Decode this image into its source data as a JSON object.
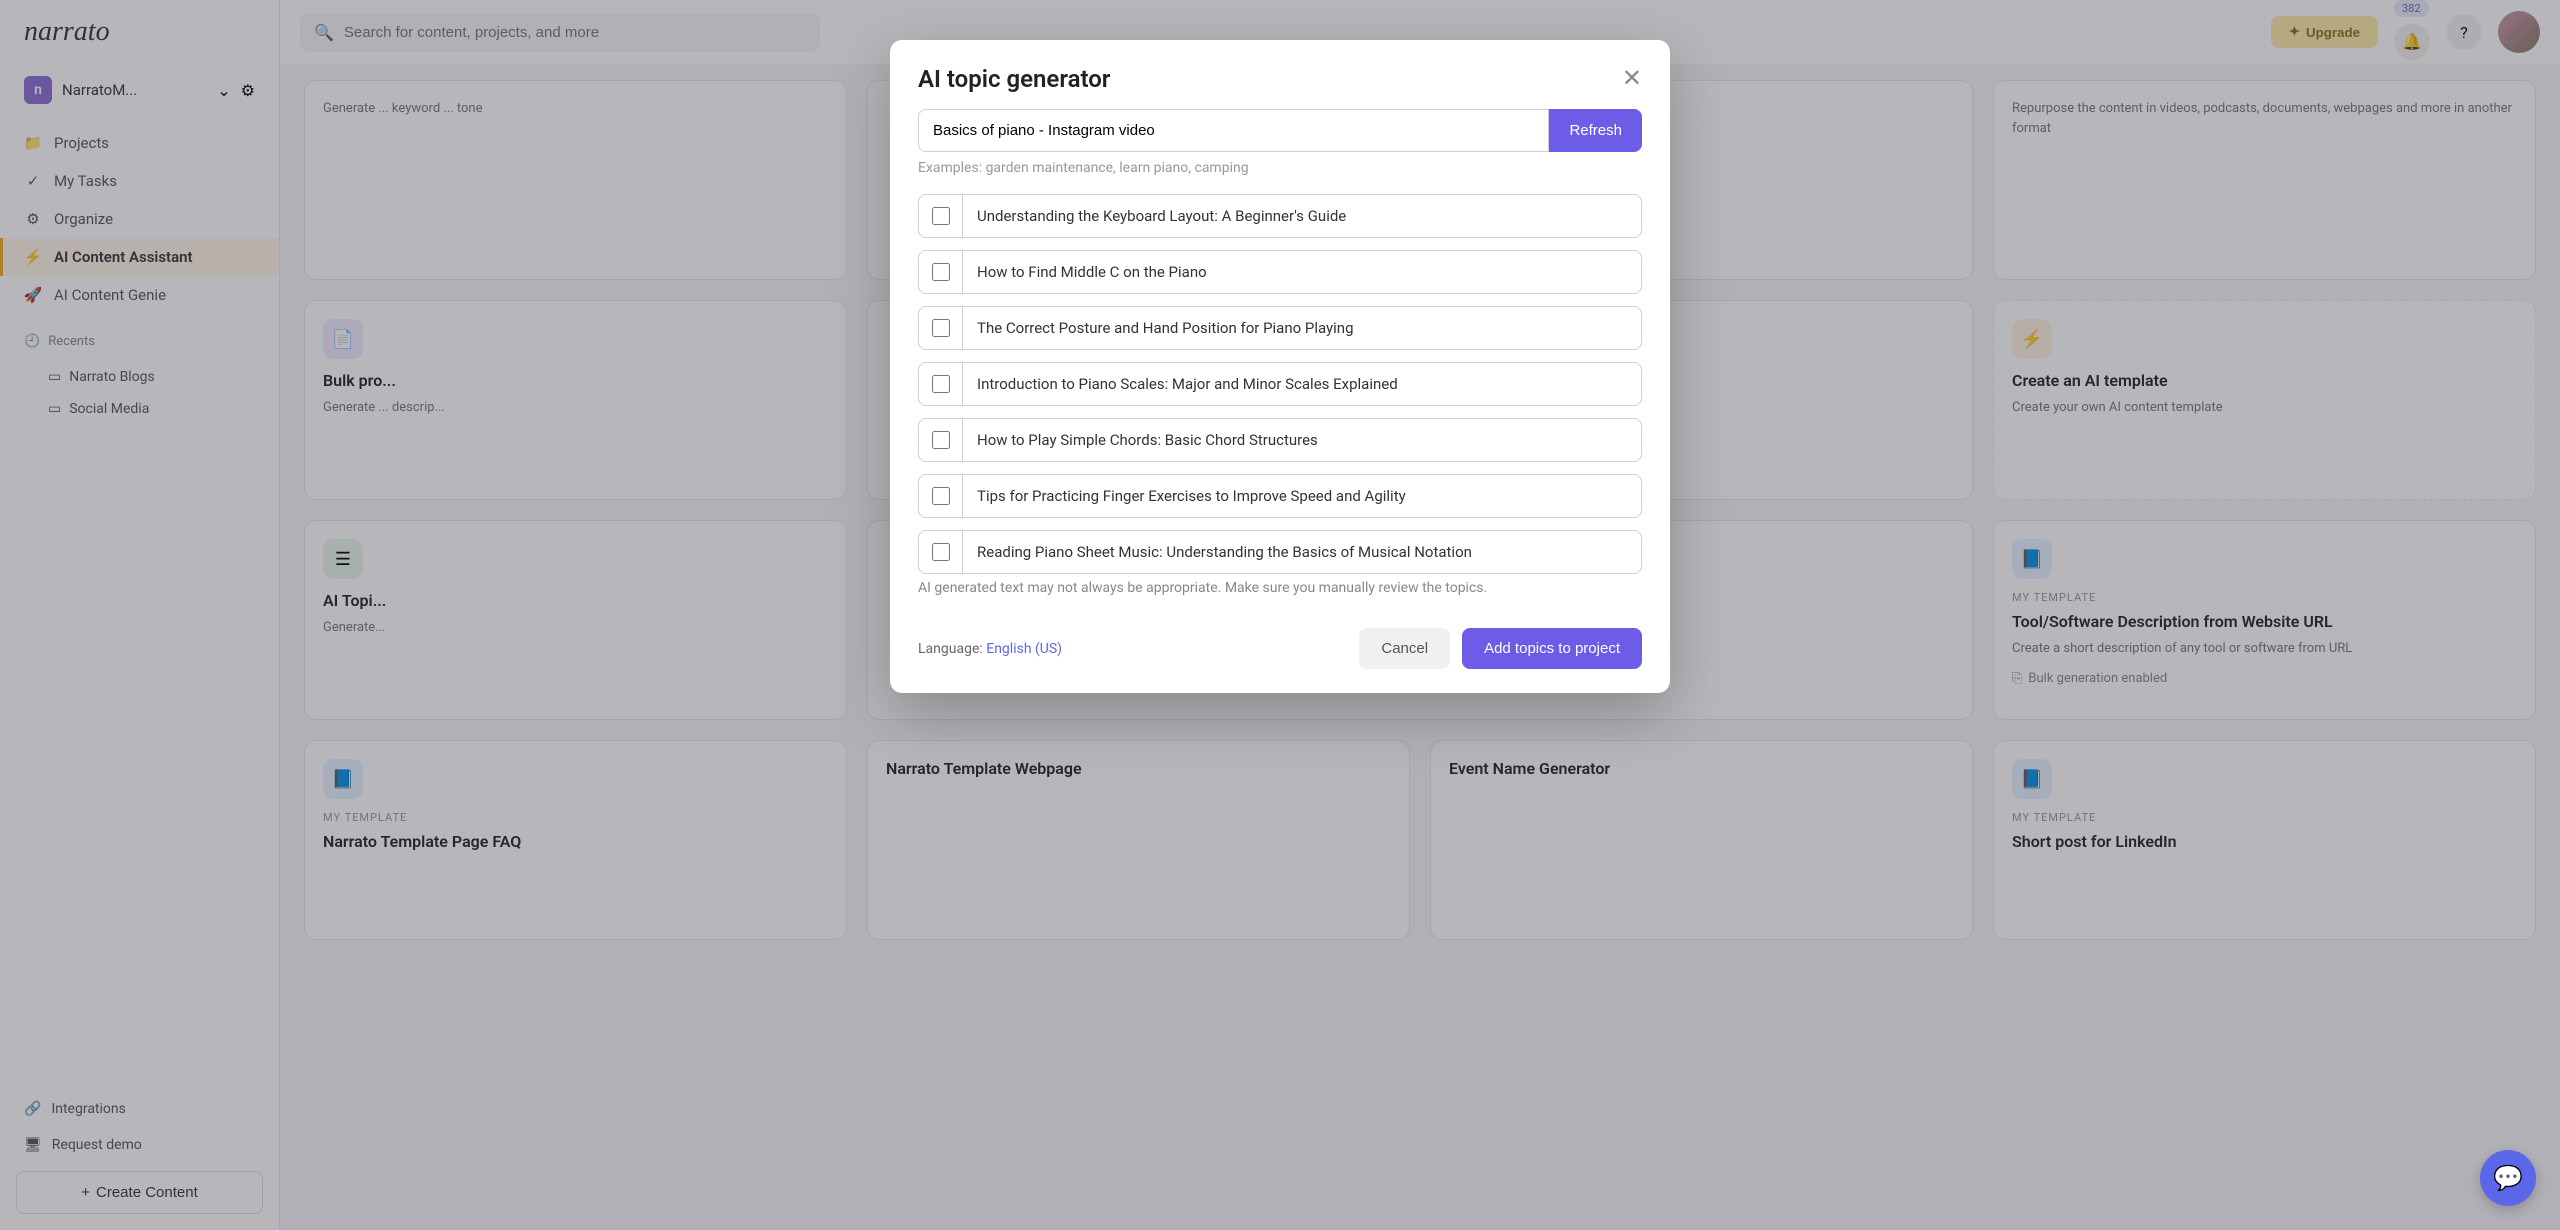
{
  "app": {
    "logo": "narrato"
  },
  "workspace": {
    "badge": "n",
    "name": "NarratoM..."
  },
  "sidebar": {
    "items": [
      {
        "label": "Projects",
        "icon": "folder"
      },
      {
        "label": "My Tasks",
        "icon": "check"
      },
      {
        "label": "Organize",
        "icon": "gear"
      },
      {
        "label": "AI Content Assistant",
        "icon": "bolt"
      },
      {
        "label": "AI Content Genie",
        "icon": "rocket"
      }
    ],
    "recents_label": "Recents",
    "recents": [
      {
        "label": "Narrato Blogs"
      },
      {
        "label": "Social Media"
      }
    ],
    "bottom": {
      "integrations": "Integrations",
      "request_demo": "Request demo",
      "create_content": "Create Content"
    }
  },
  "topbar": {
    "search_placeholder": "Search for content, projects, and more",
    "upgrade": "Upgrade",
    "badge": "382"
  },
  "cards": {
    "c1_desc": "Generate ... keyword ... tone",
    "c2_title": "Bulk pro...",
    "c2_desc": "Generate ... descrip...",
    "c3_tag": "MY TEMPLATE",
    "c3_title": "Tool/Software Description from Website URL",
    "c3_desc": "Create a short description of any tool or software from URL",
    "c3_bulk": "Bulk generation enabled",
    "c4_title": "Create an AI template",
    "c4_desc": "Create your own AI content template",
    "c5_title": "AI Topi...",
    "c5_desc": "Generate...",
    "c6_desc": "Repurpose the content in videos, podcasts, documents, webpages and more in another format",
    "c7_title": "Narrato Template Page FAQ",
    "c8_title": "Narrato Template Webpage",
    "c9_title": "Event Name Generator",
    "c10_title": "Short post for LinkedIn",
    "my_template": "MY TEMPLATE"
  },
  "modal": {
    "title": "AI topic generator",
    "input_value": "Basics of piano - Instagram video",
    "refresh": "Refresh",
    "examples": "Examples: garden maintenance, learn piano, camping",
    "topics": [
      "Understanding the Keyboard Layout: A Beginner's Guide",
      "How to Find Middle C on the Piano",
      "The Correct Posture and Hand Position for Piano Playing",
      "Introduction to Piano Scales: Major and Minor Scales Explained",
      "How to Play Simple Chords: Basic Chord Structures",
      "Tips for Practicing Finger Exercises to Improve Speed and Agility",
      "Reading Piano Sheet Music: Understanding the Basics of Musical Notation"
    ],
    "disclaimer": "AI generated text may not always be appropriate. Make sure you manually review the topics.",
    "cancel": "Cancel",
    "add": "Add topics to project",
    "language_label": "Language: ",
    "language_value": "English (US)"
  }
}
